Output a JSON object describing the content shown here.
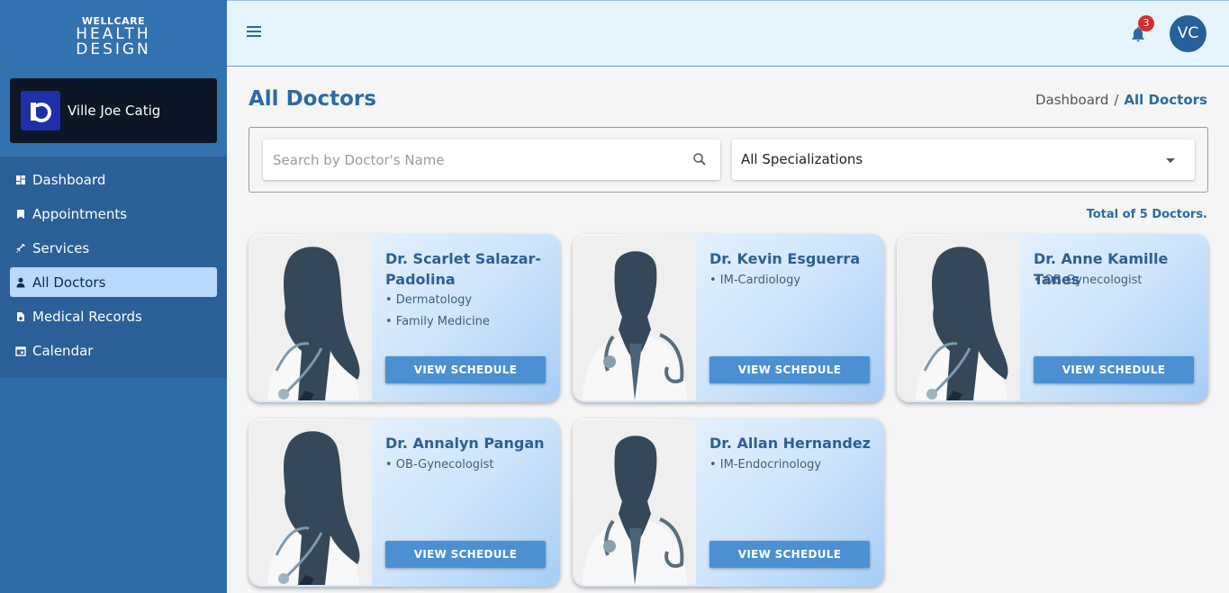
{
  "brand": {
    "line1": "WELLCARE",
    "line2": "HEALTH",
    "line3": "DESIGN"
  },
  "user": {
    "name": "Ville Joe Catig"
  },
  "nav": [
    {
      "label": "Dashboard",
      "icon": "dashboard-icon"
    },
    {
      "label": "Appointments",
      "icon": "bookmark-icon"
    },
    {
      "label": "Services",
      "icon": "syringe-icon"
    },
    {
      "label": "All Doctors",
      "icon": "doctor-icon",
      "active": true
    },
    {
      "label": "Medical Records",
      "icon": "file-icon"
    },
    {
      "label": "Calendar",
      "icon": "calendar-icon"
    }
  ],
  "header": {
    "notification_count": "3",
    "avatar_initials": "VC"
  },
  "page": {
    "title": "All Doctors"
  },
  "breadcrumb": {
    "home": "Dashboard",
    "separator": "/",
    "current": "All Doctors"
  },
  "filters": {
    "search_placeholder": "Search by Doctor's Name",
    "specialization": "All Specializations"
  },
  "total_text": "Total of 5 Doctors.",
  "doctors": [
    {
      "name": "Dr. Scarlet Salazar-Padolina",
      "gender": "female",
      "specs": [
        "• Dermatology",
        "• Family Medicine"
      ],
      "button": "VIEW SCHEDULE"
    },
    {
      "name": "Dr. Kevin Esguerra",
      "gender": "male",
      "specs": [
        "• IM-Cardiology"
      ],
      "button": "VIEW SCHEDULE"
    },
    {
      "name": "Dr. Anne Kamille Tanes",
      "gender": "female",
      "specs": [
        "• OB-Gynecologist"
      ],
      "button": "VIEW SCHEDULE"
    },
    {
      "name": "Dr. Annalyn Pangan",
      "gender": "female",
      "specs": [
        "• OB-Gynecologist"
      ],
      "button": "VIEW SCHEDULE"
    },
    {
      "name": "Dr. Allan Hernandez",
      "gender": "male",
      "specs": [
        "• IM-Endocrinology"
      ],
      "button": "VIEW SCHEDULE"
    }
  ],
  "colors": {
    "sidebar": "#2e6ca8",
    "accent": "#2c6aa6",
    "button": "#4b90d3",
    "active_nav": "#b8d9fb",
    "badge": "#d32f2f"
  }
}
